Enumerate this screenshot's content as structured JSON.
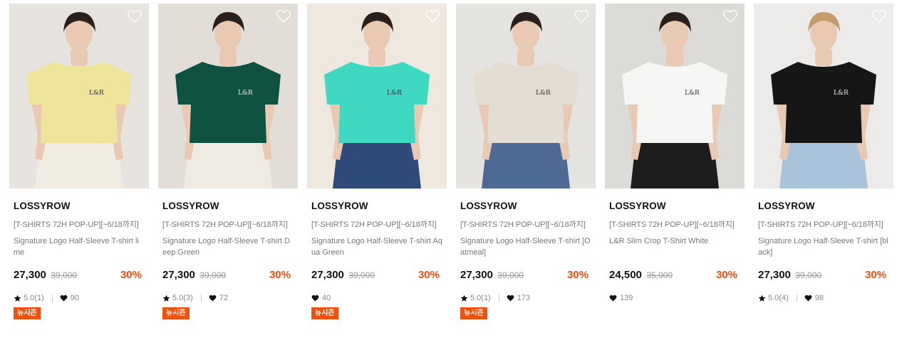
{
  "products": [
    {
      "brand": "LOSSYROW",
      "promo": "[T-SHIRTS 72H POP-UP][~6/18까지]",
      "name": "Signature Logo Half-Sleeve T-shirt lime",
      "price": "27,300",
      "original_price": "39,000",
      "discount": "30%",
      "rating": "5.0(1)",
      "likes": "90",
      "badge": "뉴시즌",
      "shirt_color": "#eee59a",
      "bottom_color": "#f1ece1",
      "bg_color": "#e7e4df"
    },
    {
      "brand": "LOSSYROW",
      "promo": "[T-SHIRTS 72H POP-UP][~6/18까지]",
      "name": "Signature Logo Half-Sleeve T-shirt Deep Green",
      "price": "27,300",
      "original_price": "39,000",
      "discount": "30%",
      "rating": "5.0(3)",
      "likes": "72",
      "badge": "뉴시즌",
      "shirt_color": "#0f5242",
      "bottom_color": "#efebe2",
      "bg_color": "#e2ded7"
    },
    {
      "brand": "LOSSYROW",
      "promo": "[T-SHIRTS 72H POP-UP][~6/18까지]",
      "name": "Signature Logo Half-Sleeve T-shirt Aqua Green",
      "price": "27,300",
      "original_price": "39,000",
      "discount": "30%",
      "rating": "",
      "likes": "40",
      "badge": "뉴시즌",
      "shirt_color": "#3fd8c3",
      "bottom_color": "#2e4a78",
      "bg_color": "#efe8df"
    },
    {
      "brand": "LOSSYROW",
      "promo": "[T-SHIRTS 72H POP-UP][~6/18까지]",
      "name": "Signature Logo Half-Sleeve T-shirt [Oatmeal]",
      "price": "27,300",
      "original_price": "39,000",
      "discount": "30%",
      "rating": "5.0(1)",
      "likes": "173",
      "badge": "뉴시즌",
      "shirt_color": "#e3ddd4",
      "bottom_color": "#4c6a94",
      "bg_color": "#e6e4e1"
    },
    {
      "brand": "LOSSYROW",
      "promo": "[T-SHIRTS 72H POP-UP][~6/18까지]",
      "name": "L&R Slim Crop T-Shirt White",
      "price": "24,500",
      "original_price": "35,000",
      "discount": "30%",
      "rating": "",
      "likes": "139",
      "badge": "",
      "shirt_color": "#f6f6f4",
      "bottom_color": "#1d1d1d",
      "bg_color": "#dcdbd8"
    },
    {
      "brand": "LOSSYROW",
      "promo": "[T-SHIRTS 72H POP-UP][~6/18까지]",
      "name": "Signature Logo Half-Sleeve T-shirt [black]",
      "price": "27,300",
      "original_price": "39,000",
      "discount": "30%",
      "rating": "5.0(4)",
      "likes": "98",
      "badge": "",
      "shirt_color": "#161616",
      "bottom_color": "#a9c3da",
      "bg_color": "#ecebe9"
    }
  ],
  "colors": {
    "accent": "#f2500f",
    "text_muted": "#777777"
  },
  "icons": {
    "wishlist": "heart-outline-icon",
    "rating": "star-icon",
    "likes": "heart-filled-icon"
  }
}
